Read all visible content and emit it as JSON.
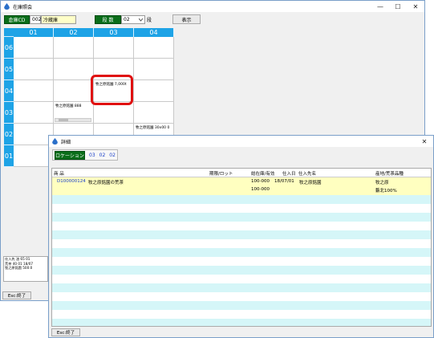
{
  "main_window": {
    "title": "在庫照会",
    "minimize": "—",
    "maximize": "☐",
    "close": "✕",
    "toolbar": {
      "warehouse_label": "倉庫CD",
      "warehouse_code": "002",
      "warehouse_name": "冷蔵庫",
      "tier_label": "段 数",
      "tier_value": "02",
      "tier_unit": "段",
      "show_button": "表示"
    },
    "columns": [
      "01",
      "02",
      "03",
      "04"
    ],
    "rows": [
      "06",
      "05",
      "04",
      "03",
      "02",
      "01"
    ],
    "cells": {
      "r04_c03": "牧之原銘園 7,000t",
      "r03_c02": "牧之原銘園 888",
      "r02_c04": "牧之原銘園 30x00 0"
    },
    "bottom_panel": [
      "仕入先 油 65 01",
      "荒茶 40 01 18/07",
      "牧之原銘園 500:0"
    ],
    "esc_button": "Esc:終了"
  },
  "detail_window": {
    "title": "詳細",
    "close": "✕",
    "location_label": "ロケーション",
    "location_values": [
      "03",
      "02",
      "02"
    ],
    "headers": {
      "product": "商 品",
      "period_lot": "期限/ロット",
      "total_stock": "総在庫/有効",
      "arrival_date": "仕入日",
      "supplier": "仕入先名",
      "origin": "産地/荒茶品種"
    },
    "row": {
      "code": "D100000124",
      "name": "牧之原銘園の荒茶",
      "stock_total": "100-000",
      "stock_valid": "100-000",
      "date": "18/07/01",
      "supplier": "牧之原銘園",
      "origin": "牧之原",
      "variety": "藪北100%"
    },
    "esc_button": "Esc:終了"
  }
}
